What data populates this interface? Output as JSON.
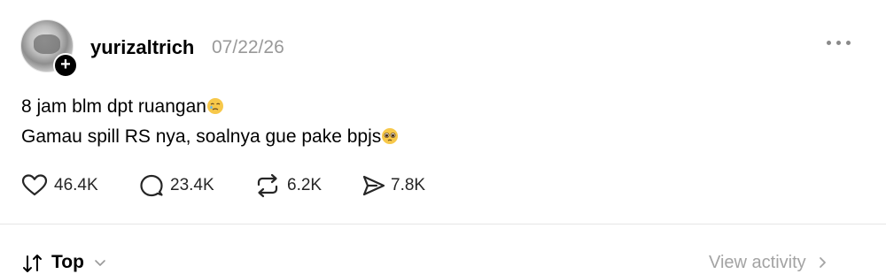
{
  "post": {
    "username": "yurizaltrich",
    "date": "07/22/26",
    "text_line_1": "8 jam blm dpt ruangan",
    "text_line_2": "Gamau spill RS nya, soalnya gue pake bpjs",
    "emoji_line_1": "face-holding-back-tears-emoji",
    "emoji_line_2": "pleading-face-emoji"
  },
  "actions": {
    "likes": "46.4K",
    "comments": "23.4K",
    "reposts": "6.2K",
    "shares": "7.8K"
  },
  "replies_bar": {
    "sort_label": "Top",
    "view_activity": "View activity"
  },
  "icons": {
    "more": "more-horizontal-icon",
    "follow": "plus-icon",
    "like": "heart-icon",
    "comment": "comment-bubble-icon",
    "repost": "repost-icon",
    "share": "send-icon",
    "sort": "sort-arrows-icon",
    "chevron_down": "chevron-down-icon",
    "chevron_right": "chevron-right-icon"
  },
  "colors": {
    "text_primary": "#000000",
    "text_secondary": "#999999",
    "divider": "#e6e6e6"
  }
}
